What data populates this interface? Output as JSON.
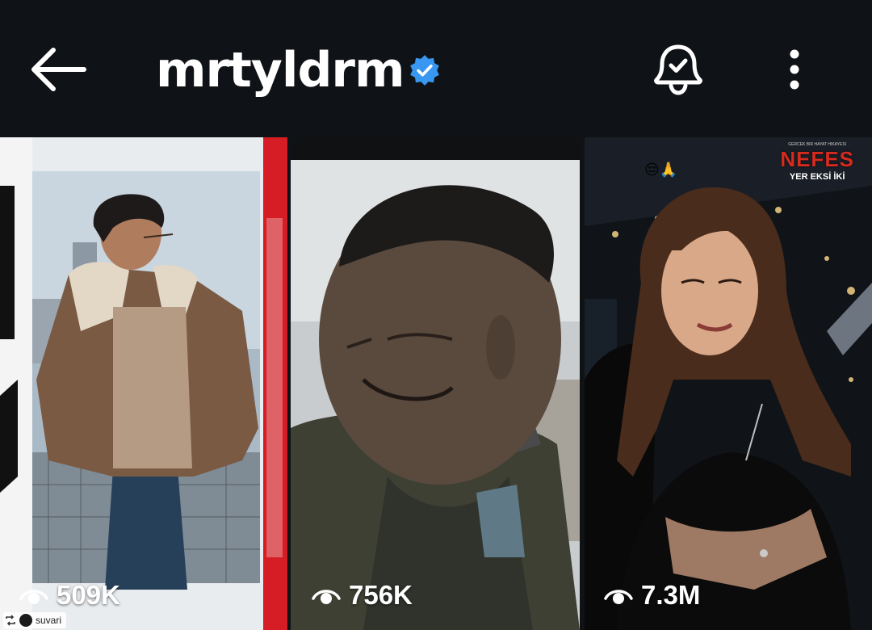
{
  "header": {
    "username": "mrtyldrm",
    "back_icon": "arrow-left-icon",
    "verified_icon": "verified-badge-icon",
    "bell_icon": "bell-check-icon",
    "more_icon": "more-vertical-icon"
  },
  "tiles": [
    {
      "views": "509K",
      "repost_label": "suvari",
      "description_icon": "eye-icon"
    },
    {
      "views": "756K",
      "description_icon": "eye-icon"
    },
    {
      "views": "7.3M",
      "description_icon": "eye-icon",
      "logo_top": "GERCEK BIR HAYAT HIKAYESI",
      "logo_title": "NEFES",
      "logo_sub": "YER EKSİ İKİ",
      "emojis": "😔🙏"
    }
  ],
  "colors": {
    "background": "#0f1216",
    "verified": "#3897f0",
    "text": "#ffffff"
  }
}
